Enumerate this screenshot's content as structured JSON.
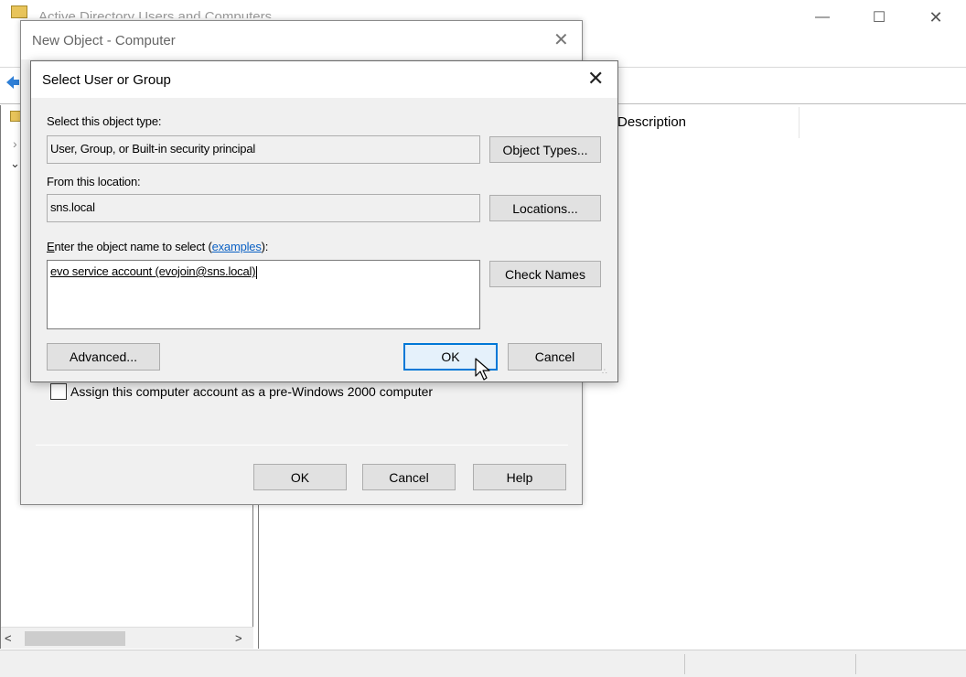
{
  "main_window": {
    "title": "Active Directory Users and Computers",
    "caption_buttons": {
      "minimize": "—",
      "maximize": "☐",
      "close": "✕"
    },
    "list": {
      "columns": [
        "Description"
      ]
    },
    "tree": {
      "expand_glyphs": [
        "›",
        "⌄"
      ]
    },
    "scroll": {
      "left": "<",
      "right": ">"
    }
  },
  "new_object_dialog": {
    "title": "New Object - Computer",
    "close": "✕",
    "prewin2000_checkbox": {
      "label": "Assign this computer account as a pre-Windows 2000 computer",
      "checked": false
    },
    "buttons": {
      "ok": "OK",
      "cancel": "Cancel",
      "help": "Help"
    }
  },
  "select_dialog": {
    "title": "Select User or Group",
    "close": "✕",
    "object_type": {
      "label": "Select this object type:",
      "value": "User, Group, or Built-in security principal",
      "button": "Object Types..."
    },
    "location": {
      "label": "From this location:",
      "value": "sns.local",
      "button": "Locations..."
    },
    "object_name": {
      "label_prefix": "nter the object name to select (",
      "access_key": "E",
      "link": "examples",
      "label_suffix": "):",
      "value": "evo service account (evojoin@sns.local)",
      "button": "Check Names"
    },
    "buttons": {
      "advanced": "Advanced...",
      "ok": "OK",
      "cancel": "Cancel"
    }
  },
  "colors": {
    "accent": "#0078d7",
    "link": "#0b61c4",
    "dialog_bg": "#f0f0f0"
  },
  "icons": [
    "app-icon",
    "back-arrow-icon",
    "folder-icon",
    "mouse-cursor-icon"
  ]
}
